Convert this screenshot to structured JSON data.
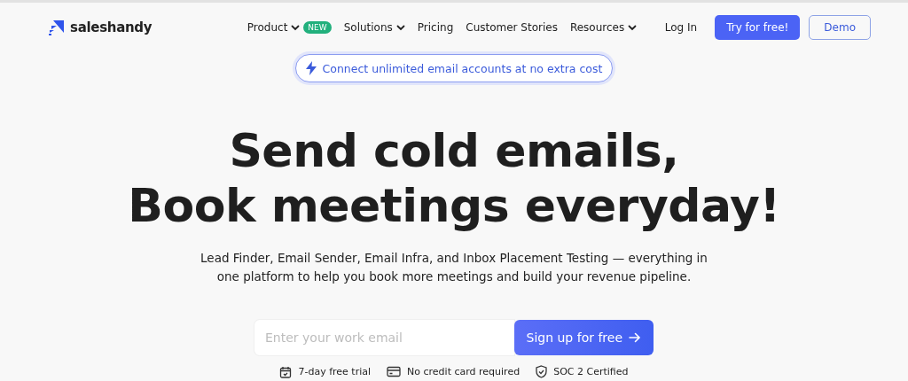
{
  "brand": {
    "name": "saleshandy"
  },
  "nav": [
    {
      "label": "Product",
      "has_menu": true,
      "badge": "NEW"
    },
    {
      "label": "Solutions",
      "has_menu": true
    },
    {
      "label": "Pricing",
      "has_menu": false
    },
    {
      "label": "Customer Stories",
      "has_menu": false
    },
    {
      "label": "Resources",
      "has_menu": true
    }
  ],
  "actions": {
    "login": "Log In",
    "primary": "Try for free!",
    "secondary": "Demo"
  },
  "announcement": "Connect unlimited email accounts at no extra cost",
  "headline": [
    "Send cold emails,",
    "Book meetings everyday!"
  ],
  "subtitle": "Lead Finder, Email Sender, Email Infra, and Inbox Placement Testing — everything in one platform to help you book more meetings and build your revenue pipeline.",
  "signup": {
    "placeholder": "Enter your work email",
    "button": "Sign up for free"
  },
  "trust": [
    {
      "kind": "calendar",
      "label": "7-day free trial"
    },
    {
      "kind": "card",
      "label": "No credit card required"
    },
    {
      "kind": "shield",
      "label": "SOC 2 Certified"
    }
  ]
}
